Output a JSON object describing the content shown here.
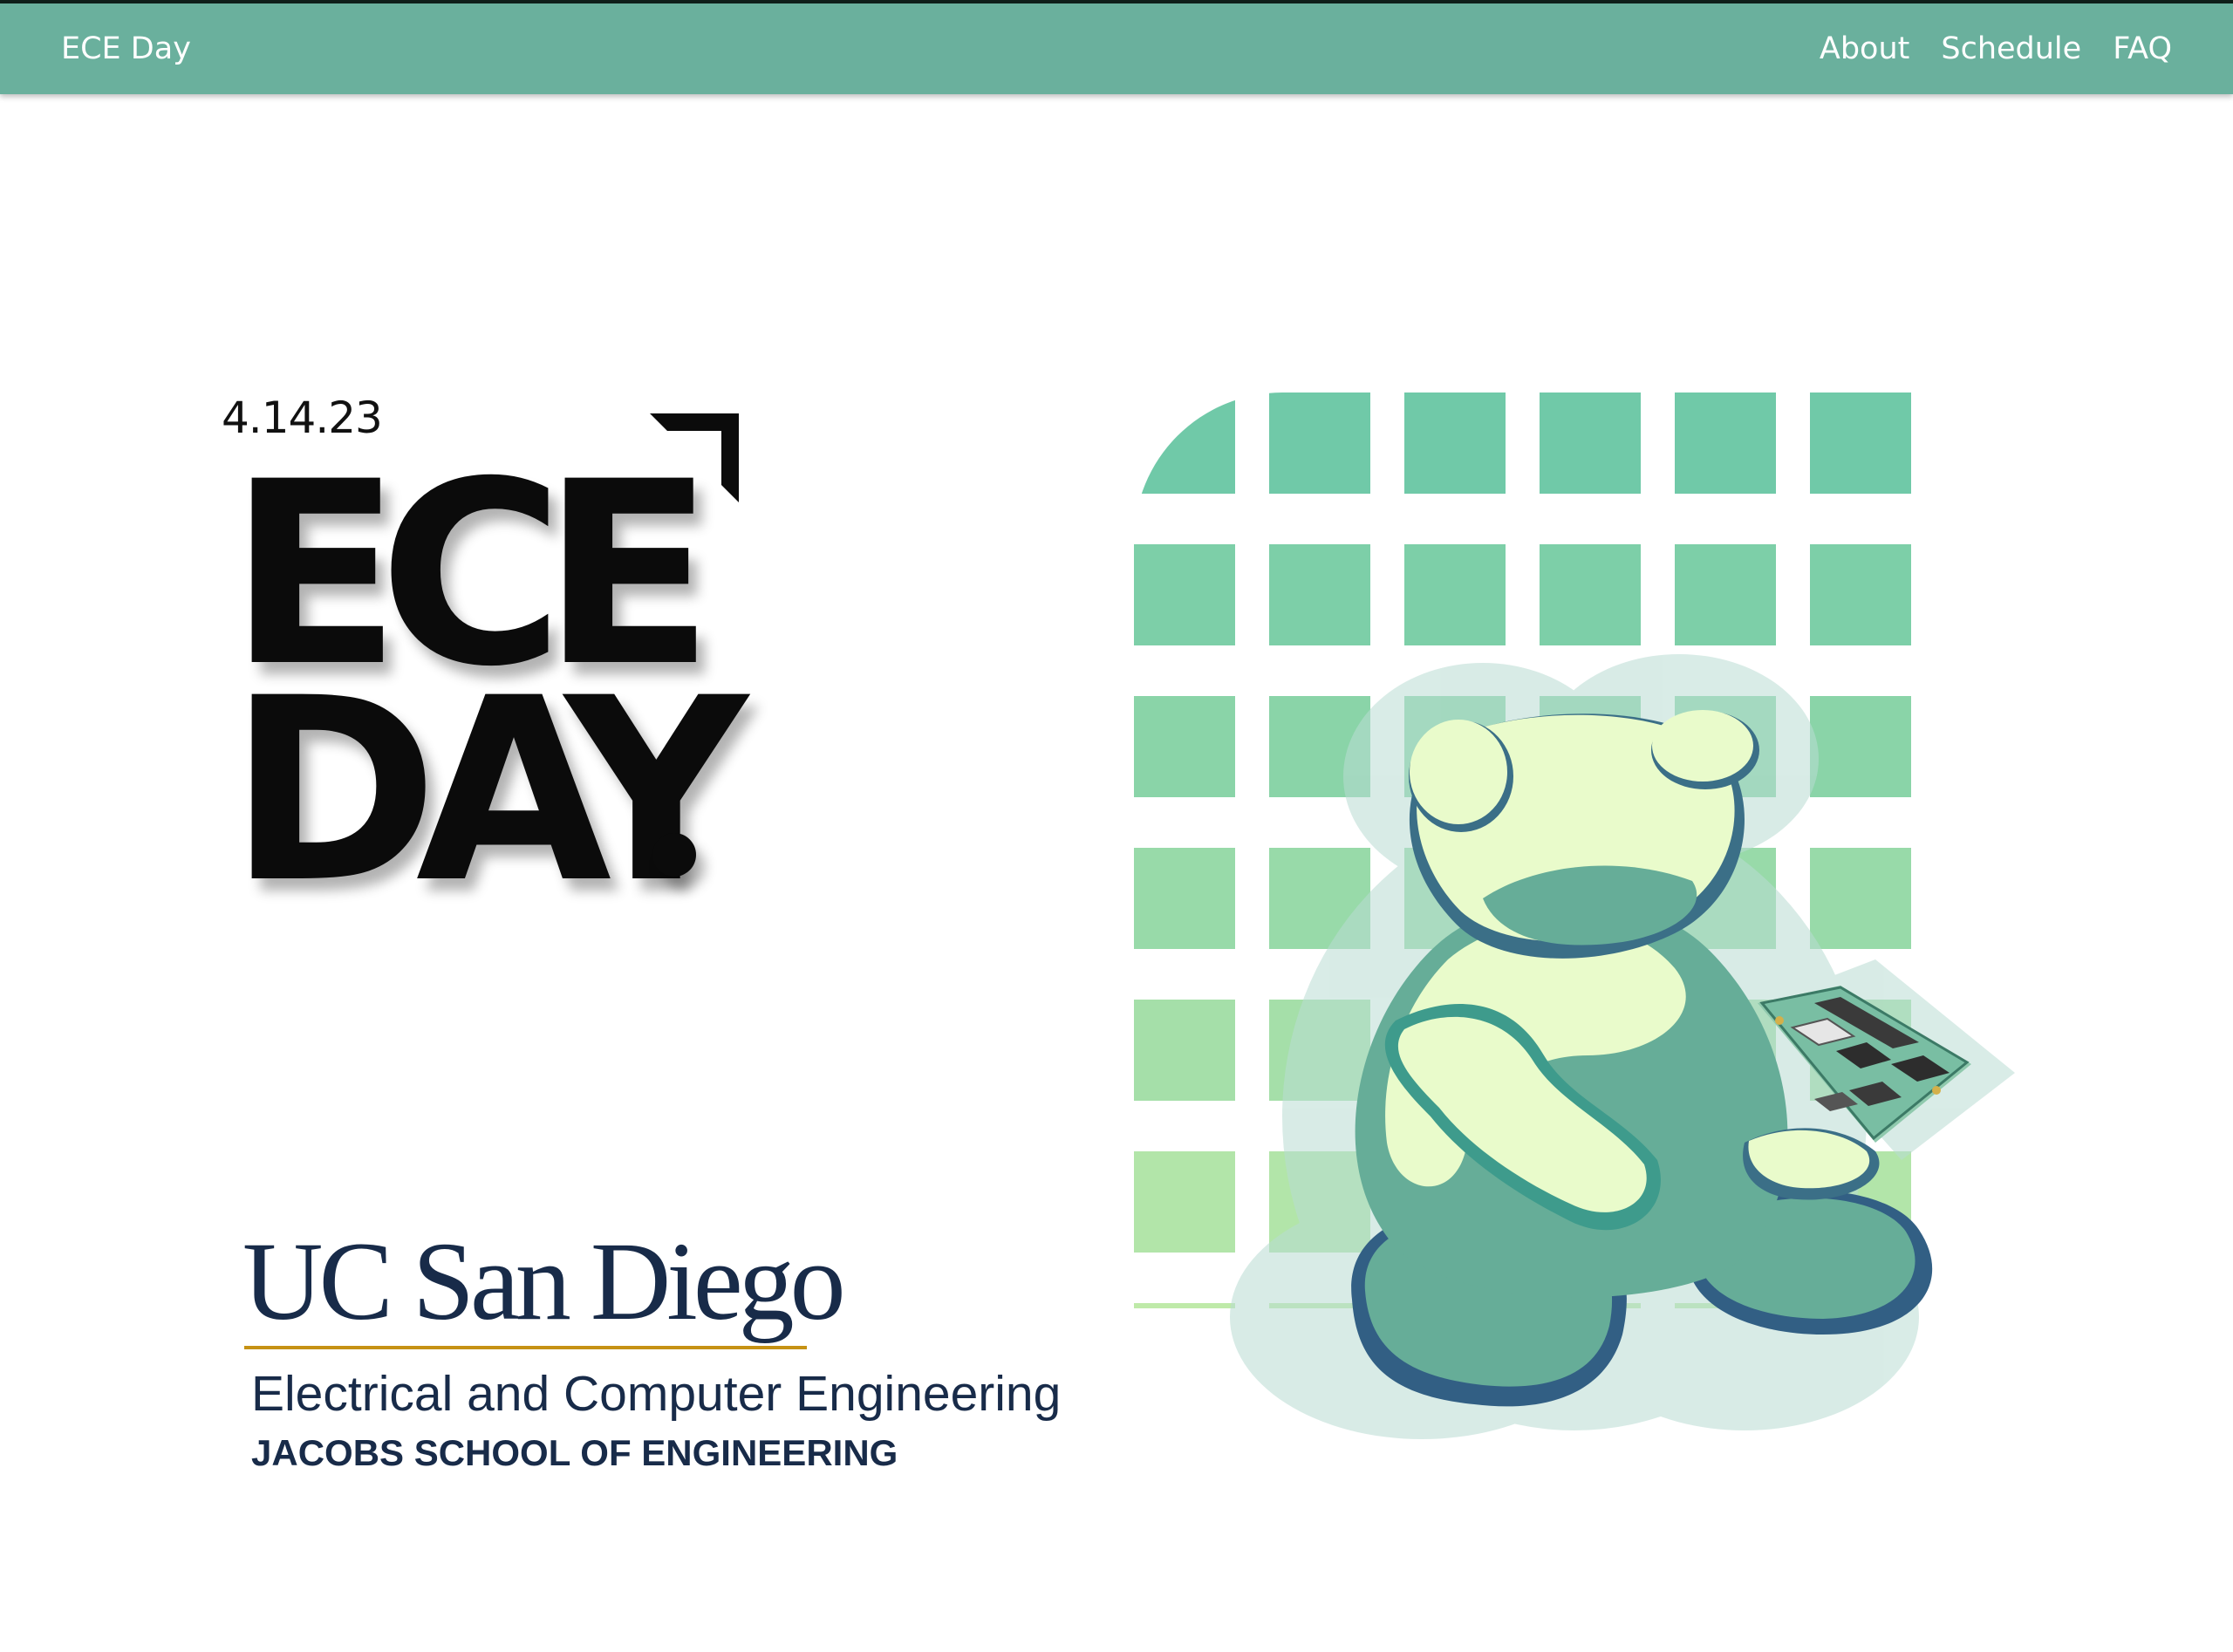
{
  "colors": {
    "nav_background": "#6ab09d",
    "nav_text": "#ffffff",
    "logo_text": "#0b0b0b",
    "ucsd_navy": "#182b49",
    "ucsd_gold": "#c69214",
    "grid_top": "#70c9a8",
    "grid_bottom": "#bfeaa9",
    "bear_light": "#e9fbcb",
    "bear_mid": "#66ad98",
    "bear_dark": "#325f84"
  },
  "nav": {
    "brand": "ECE Day",
    "links": [
      "About",
      "Schedule",
      "FAQ"
    ]
  },
  "hero": {
    "date": "4.14.23",
    "logo_line1": "ECE",
    "logo_line2": "DAY"
  },
  "sponsor": {
    "university": "UC San Diego",
    "department": "Electrical and Computer Engineering",
    "school": "JACOBS SCHOOL OF ENGINEERING"
  },
  "illustration": {
    "icon": "bear-holding-circuit-board-icon",
    "grid_rows": 7,
    "grid_cols": 6
  }
}
